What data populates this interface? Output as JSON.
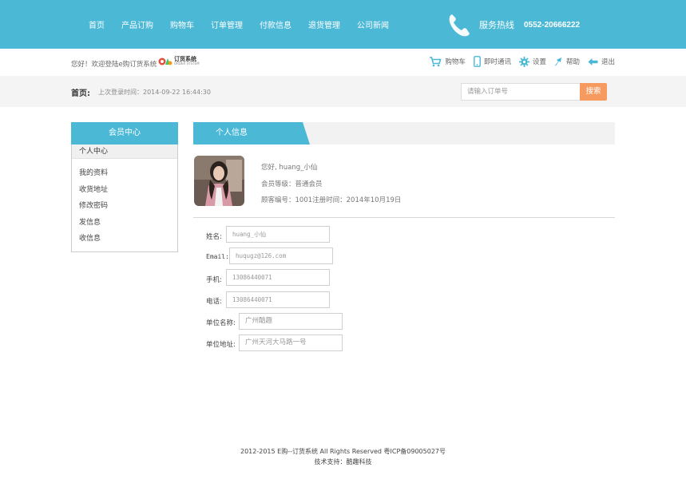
{
  "nav": {
    "items": [
      "首页",
      "产品订购",
      "购物车",
      "订单管理",
      "付款信息",
      "退货管理",
      "公司新闻"
    ]
  },
  "hotline": {
    "label": "服务热线",
    "number": "0552-20666222"
  },
  "subheader": {
    "welcome": "您好！欢迎登陆e购订货系统",
    "logo_title": "订货系统",
    "logo_subtitle": "ORDER SYSTEM",
    "tools": [
      {
        "label": "购物车",
        "icon": "cart-icon"
      },
      {
        "label": "即时通讯",
        "icon": "mobile-icon"
      },
      {
        "label": "设置",
        "icon": "gear-icon"
      },
      {
        "label": "帮助",
        "icon": "help-icon"
      },
      {
        "label": "退出",
        "icon": "logout-icon"
      }
    ]
  },
  "graybar": {
    "home": "首页:",
    "last_login": "上次登录时间：2014-09-22 16:44:30",
    "search_placeholder": "请输入订单号",
    "search_button": "搜索"
  },
  "sidebar": {
    "title": "会员中心",
    "section": "个人中心",
    "links": [
      "我的资料",
      "收货地址",
      "修改密码",
      "发信息",
      "收信息"
    ]
  },
  "panel": {
    "title": "个人信息",
    "greeting": "您好, huang_小仙",
    "level": "会员等级：普通会员",
    "customer": "顾客编号：1001注册时间：2014年10月19日"
  },
  "form": [
    {
      "label": "姓名:",
      "value": "huang_小仙"
    },
    {
      "label": "Email:",
      "value": "huqugz@126.com"
    },
    {
      "label": "手机:",
      "value": "13086440071"
    },
    {
      "label": "电话:",
      "value": "13086440071"
    },
    {
      "label": "单位名称:",
      "value": "广州酷趣"
    },
    {
      "label": "单位地址:",
      "value": "广州天河大马路一号"
    }
  ],
  "footer": {
    "line1": "2012-2015 E购--订货系统 All Rights Reserved 粤ICP备09005027号",
    "line2": "技术支持：酷趣科技"
  },
  "colors": {
    "accent": "#4bb8d6",
    "search_button": "#f79a60",
    "gray_bar": "#f4f4f4"
  }
}
